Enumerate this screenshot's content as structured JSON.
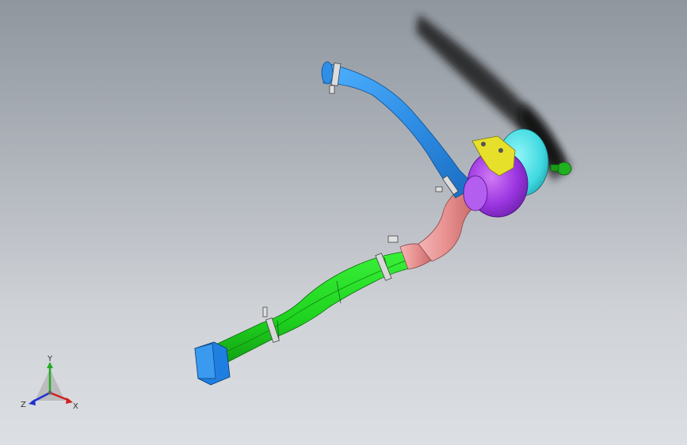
{
  "viewport": {
    "background_top": "#8f969e",
    "background_bottom": "#dcdfe3"
  },
  "parts": {
    "intake_tube_color": "#2f8fe6",
    "filter_housing_color": "#9b35e0",
    "filter_cap_color": "#3fd9e0",
    "bracket_color": "#e6e02a",
    "elbow_color": "#e89090",
    "duct_color": "#1fd21f",
    "inlet_box_color": "#1f7fe0",
    "valve_color": "#20b020"
  },
  "triad": {
    "y_label": "Y",
    "x_label": "X",
    "z_label": "Z"
  }
}
